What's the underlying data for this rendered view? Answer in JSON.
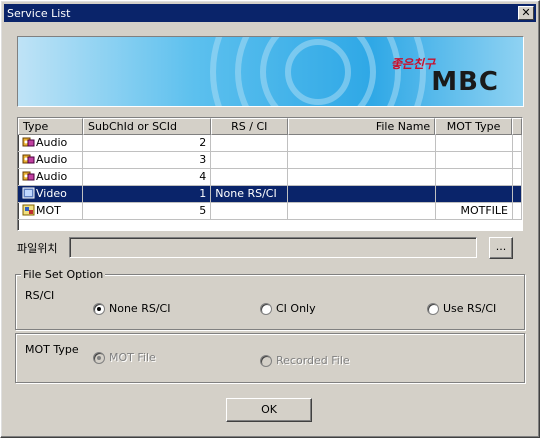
{
  "window": {
    "title": "Service List",
    "close_glyph": "✕"
  },
  "banner": {
    "logo_sub": "좋은친구",
    "logo": "MBC"
  },
  "list": {
    "columns": [
      "Type",
      "SubChId or SCId",
      "RS / CI",
      "File Name",
      "MOT Type"
    ],
    "rows": [
      {
        "type": "Audio",
        "icon": "audio-icon",
        "subch": "2",
        "rsci": "",
        "file": "",
        "mot": ""
      },
      {
        "type": "Audio",
        "icon": "audio-icon",
        "subch": "3",
        "rsci": "",
        "file": "",
        "mot": ""
      },
      {
        "type": "Audio",
        "icon": "audio-icon",
        "subch": "4",
        "rsci": "",
        "file": "",
        "mot": ""
      },
      {
        "type": "Video",
        "icon": "video-icon",
        "subch": "1",
        "rsci": "None RS/CI",
        "file": "",
        "mot": "",
        "selected": true
      },
      {
        "type": "MOT",
        "icon": "mot-icon",
        "subch": "5",
        "rsci": "",
        "file": "",
        "mot": "MOTFILE"
      }
    ]
  },
  "file_location": {
    "label": "파일위치",
    "value": "",
    "browse_label": "..."
  },
  "file_set_option": {
    "title": "File Set Option",
    "rsci_label": "RS/CI",
    "rsci_options": [
      {
        "label": "None RS/CI",
        "checked": true
      },
      {
        "label": "CI Only",
        "checked": false
      },
      {
        "label": "Use RS/CI",
        "checked": false
      }
    ],
    "mot_label": "MOT Type",
    "mot_options": [
      {
        "label": "MOT File",
        "checked": true,
        "disabled": true
      },
      {
        "label": "Recorded File",
        "checked": false,
        "disabled": true
      }
    ]
  },
  "ok_label": "OK",
  "colors": {
    "titlebar": "#0a246a",
    "selection": "#0a246a",
    "face": "#d4d0c8"
  }
}
